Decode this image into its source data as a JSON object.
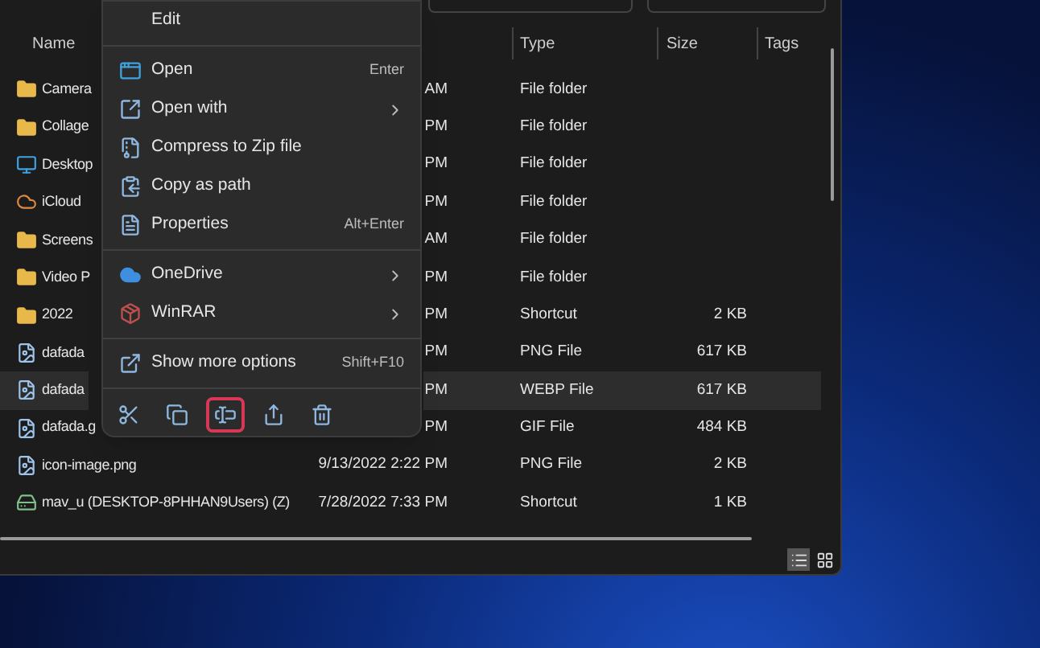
{
  "file_list": {
    "columns": [
      {
        "label": "Name"
      },
      {
        "label": "Type"
      },
      {
        "label": "Size"
      },
      {
        "label": "Tags"
      }
    ],
    "rows": [
      {
        "kind": "folder",
        "name": "Camera",
        "date": "AM",
        "type": "File folder",
        "selected": false
      },
      {
        "kind": "folder",
        "name": "Collage",
        "date": "PM",
        "type": "File folder",
        "selected": false
      },
      {
        "kind": "desktop",
        "name": "Desktop",
        "date": "PM",
        "type": "File folder",
        "selected": false
      },
      {
        "kind": "cloud",
        "name": "iCloud",
        "date": "PM",
        "type": "File folder",
        "selected": false
      },
      {
        "kind": "folder",
        "name": "Screens",
        "date": "AM",
        "type": "File folder",
        "selected": false
      },
      {
        "kind": "folder",
        "name": "Video P",
        "date": "PM",
        "type": "File folder",
        "selected": false
      },
      {
        "kind": "folder",
        "name": "2022",
        "date": "PM",
        "type": "Shortcut",
        "size": "2 KB",
        "selected": false
      },
      {
        "kind": "image",
        "name": "dafada",
        "date": "PM",
        "type": "PNG File",
        "size": "617 KB",
        "selected": false
      },
      {
        "kind": "image",
        "name": "dafada",
        "date": "PM",
        "type": "WEBP File",
        "size": "617 KB",
        "selected": true
      },
      {
        "kind": "image",
        "name": "dafada.g",
        "date": "PM",
        "type": "GIF File",
        "size": "484 KB",
        "selected": false
      },
      {
        "kind": "image",
        "name": "icon-image.png",
        "date": "9/13/2022 2:22 PM",
        "type": "PNG File",
        "size": "2 KB",
        "selected": false
      },
      {
        "kind": "drive",
        "name": "mav_u (DESKTOP-8PHHAN9Users) (Z)",
        "date": "7/28/2022 7:33 PM",
        "type": "Shortcut",
        "size": "1 KB",
        "selected": false
      }
    ]
  },
  "view_buttons": [
    {
      "kind": "details",
      "selected": true
    },
    {
      "kind": "tiles",
      "selected": false
    }
  ],
  "context_menu": {
    "items": [
      {
        "kind": "plain",
        "label": "Edit"
      },
      {
        "kind": "separator"
      },
      {
        "kind": "open",
        "label": "Open",
        "shortcut": "Enter",
        "submenu": false
      },
      {
        "kind": "open-with",
        "label": "Open with",
        "submenu": true
      },
      {
        "kind": "zip",
        "label": "Compress to Zip file",
        "submenu": false
      },
      {
        "kind": "path",
        "label": "Copy as path",
        "submenu": false
      },
      {
        "kind": "properties",
        "label": "Properties",
        "shortcut": "Alt+Enter",
        "submenu": false
      },
      {
        "kind": "separator"
      },
      {
        "kind": "cloud",
        "label": "OneDrive",
        "submenu": true
      },
      {
        "kind": "archive",
        "label": "WinRAR",
        "submenu": true
      },
      {
        "kind": "separator"
      },
      {
        "kind": "more",
        "label": "Show more options",
        "shortcut": "Shift+F10",
        "submenu": false
      }
    ],
    "toolbar": [
      {
        "kind": "cut",
        "highlighted": false
      },
      {
        "kind": "copy",
        "highlighted": false
      },
      {
        "kind": "rename",
        "highlighted": true
      },
      {
        "kind": "share",
        "highlighted": false
      },
      {
        "kind": "delete",
        "highlighted": false
      }
    ]
  }
}
